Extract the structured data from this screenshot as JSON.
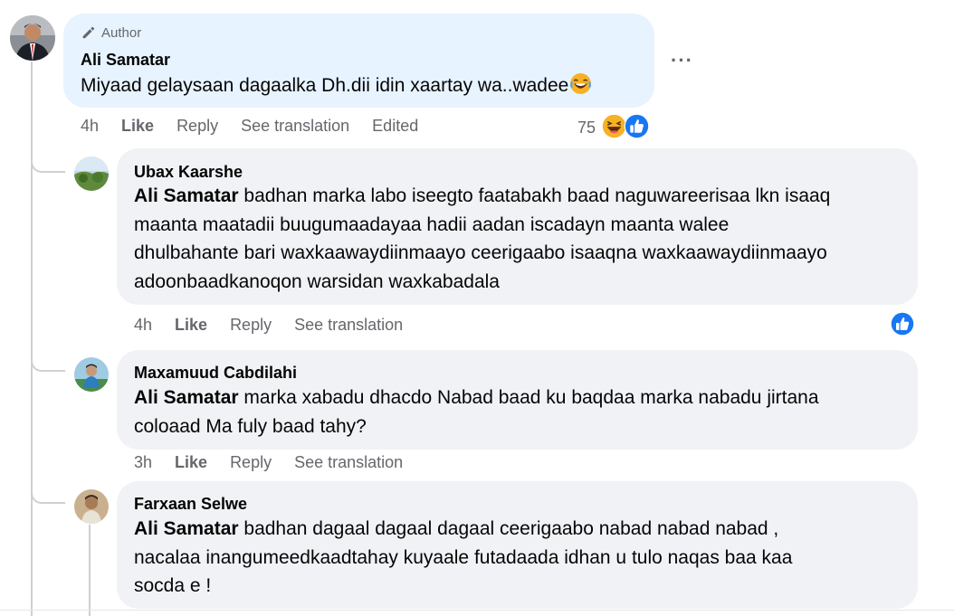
{
  "post_comment": {
    "badge": "Author",
    "name": "Ali Samatar",
    "text": "Miyaad gelaysaan dagaalka Dh.dii idin xaartay wa..wadee",
    "emoji": "laughing-emoji",
    "time": "4h",
    "like": "Like",
    "reply": "Reply",
    "see_translation": "See translation",
    "edited": "Edited",
    "reaction_count": "75",
    "more": "···"
  },
  "replies": [
    {
      "name": "Ubax Kaarshe",
      "mention": "Ali Samatar",
      "lines": [
        " badhan marka labo iseegto faatabakh baad naguwareerisaa lkn isaaq",
        "maanta maatadii buugumaadayaa hadii aadan iscadayn maanta walee",
        "dhulbahante bari waxkaawaydiinmaayo ceerigaabo isaaqna waxkaawaydiinmaayo",
        "adoonbaadkanoqon warsidan waxkabadala"
      ],
      "time": "4h",
      "like": "Like",
      "reply": "Reply",
      "see_translation": "See translation"
    },
    {
      "name": "Maxamuud Cabdilahi",
      "mention": "Ali Samatar",
      "lines": [
        " marka xabadu dhacdo Nabad baad ku baqdaa marka nabadu jirtana",
        "coloaad Ma fuly baad tahy?"
      ],
      "time": "3h",
      "like": "Like",
      "reply": "Reply",
      "see_translation": "See translation"
    },
    {
      "name": "Farxaan Selwe",
      "mention": "Ali Samatar",
      "lines": [
        " badhan dagaal dagaal dagaal ceerigaabo nabad nabad nabad ,",
        "nacalaa inangumeedkaadtahay kuyaale futadaada idhan u tulo naqas baa kaa",
        "socda e !"
      ]
    }
  ],
  "colors": {
    "author_bubble": "#e7f3ff",
    "reply_bubble": "#f0f2f5",
    "like_blue": "#1877f2",
    "meta_gray": "#65676b"
  }
}
